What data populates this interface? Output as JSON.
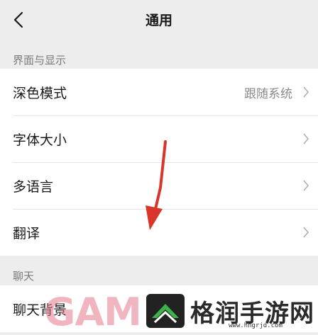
{
  "navbar": {
    "title": "通用"
  },
  "sections": [
    {
      "header": "界面与显示",
      "items": [
        {
          "label": "深色模式",
          "value": "跟随系统"
        },
        {
          "label": "字体大小",
          "value": ""
        },
        {
          "label": "多语言",
          "value": ""
        },
        {
          "label": "翻译",
          "value": ""
        }
      ]
    },
    {
      "header": "聊天",
      "items": [
        {
          "label": "聊天背景",
          "value": ""
        }
      ]
    }
  ],
  "watermark": {
    "brand": "GAM",
    "name": "格润手游网",
    "url": "www.hngrjd.com"
  },
  "colors": {
    "background": "#ededed",
    "card": "#ffffff",
    "annotation_arrow": "#d9362b"
  }
}
